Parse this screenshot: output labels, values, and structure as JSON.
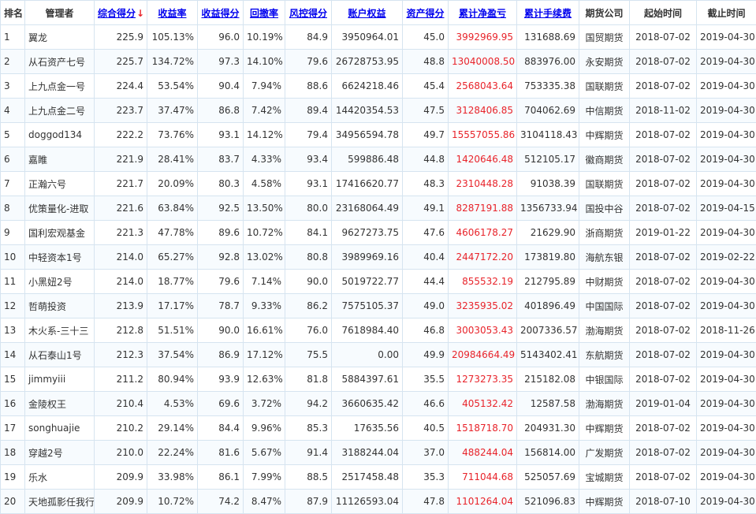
{
  "headers": {
    "rank": "排名",
    "manager": "管理者",
    "composite": "综合得分",
    "sort_arrow": "↓",
    "return_rate": "收益率",
    "return_score": "收益得分",
    "drawdown": "回撤率",
    "risk_score": "风控得分",
    "equity": "账户权益",
    "asset_score": "资产得分",
    "net_pnl": "累计净盈亏",
    "fees": "累计手续费",
    "broker": "期货公司",
    "start": "起始时间",
    "end": "截止时间"
  },
  "colors": {
    "pnl": "#e8232a",
    "link": "#0000ee",
    "border": "#d6e4f0"
  },
  "rows": [
    {
      "rank": "1",
      "manager": "翼龙",
      "composite": "225.9",
      "return_rate": "105.13%",
      "return_score": "96.0",
      "drawdown": "10.19%",
      "risk_score": "84.9",
      "equity": "3950964.01",
      "asset_score": "45.0",
      "net_pnl": "3992969.95",
      "fees": "131688.69",
      "broker": "国贸期货",
      "start": "2018-07-02",
      "end": "2019-04-30"
    },
    {
      "rank": "2",
      "manager": "从石资产七号",
      "composite": "225.7",
      "return_rate": "134.72%",
      "return_score": "97.3",
      "drawdown": "14.10%",
      "risk_score": "79.6",
      "equity": "26728753.95",
      "asset_score": "48.8",
      "net_pnl": "13040008.50",
      "fees": "883976.00",
      "broker": "永安期货",
      "start": "2018-07-02",
      "end": "2019-04-30"
    },
    {
      "rank": "3",
      "manager": "上九点金一号",
      "composite": "224.4",
      "return_rate": "53.54%",
      "return_score": "90.4",
      "drawdown": "7.94%",
      "risk_score": "88.6",
      "equity": "6624218.46",
      "asset_score": "45.4",
      "net_pnl": "2568043.64",
      "fees": "753335.38",
      "broker": "国联期货",
      "start": "2018-07-02",
      "end": "2019-04-30"
    },
    {
      "rank": "4",
      "manager": "上九点金二号",
      "composite": "223.7",
      "return_rate": "37.47%",
      "return_score": "86.8",
      "drawdown": "7.42%",
      "risk_score": "89.4",
      "equity": "14420354.53",
      "asset_score": "47.5",
      "net_pnl": "3128406.85",
      "fees": "704062.69",
      "broker": "中信期货",
      "start": "2018-11-02",
      "end": "2019-04-30"
    },
    {
      "rank": "5",
      "manager": "doggod134",
      "composite": "222.2",
      "return_rate": "73.76%",
      "return_score": "93.1",
      "drawdown": "14.12%",
      "risk_score": "79.4",
      "equity": "34956594.78",
      "asset_score": "49.7",
      "net_pnl": "15557055.86",
      "fees": "3104118.43",
      "broker": "中辉期货",
      "start": "2018-07-02",
      "end": "2019-04-30"
    },
    {
      "rank": "6",
      "manager": "嘉睢",
      "composite": "221.9",
      "return_rate": "28.41%",
      "return_score": "83.7",
      "drawdown": "4.33%",
      "risk_score": "93.4",
      "equity": "599886.48",
      "asset_score": "44.8",
      "net_pnl": "1420646.48",
      "fees": "512105.17",
      "broker": "徽商期货",
      "start": "2018-07-02",
      "end": "2019-04-30"
    },
    {
      "rank": "7",
      "manager": "正瀚六号",
      "composite": "221.7",
      "return_rate": "20.09%",
      "return_score": "80.3",
      "drawdown": "4.58%",
      "risk_score": "93.1",
      "equity": "17416620.77",
      "asset_score": "48.3",
      "net_pnl": "2310448.28",
      "fees": "91038.39",
      "broker": "国联期货",
      "start": "2018-07-02",
      "end": "2019-04-30"
    },
    {
      "rank": "8",
      "manager": "优策量化-进取",
      "composite": "221.6",
      "return_rate": "63.84%",
      "return_score": "92.5",
      "drawdown": "13.50%",
      "risk_score": "80.0",
      "equity": "23168064.49",
      "asset_score": "49.1",
      "net_pnl": "8287191.88",
      "fees": "1356733.94",
      "broker": "国投中谷",
      "start": "2018-07-02",
      "end": "2019-04-15"
    },
    {
      "rank": "9",
      "manager": "国利宏观基金",
      "composite": "221.3",
      "return_rate": "47.78%",
      "return_score": "89.6",
      "drawdown": "10.72%",
      "risk_score": "84.1",
      "equity": "9627273.75",
      "asset_score": "47.6",
      "net_pnl": "4606178.27",
      "fees": "21629.90",
      "broker": "浙商期货",
      "start": "2019-01-22",
      "end": "2019-04-30"
    },
    {
      "rank": "10",
      "manager": "中轻资本1号",
      "composite": "214.0",
      "return_rate": "65.27%",
      "return_score": "92.8",
      "drawdown": "13.02%",
      "risk_score": "80.8",
      "equity": "3989969.16",
      "asset_score": "40.4",
      "net_pnl": "2447172.20",
      "fees": "173819.80",
      "broker": "海航东银",
      "start": "2018-07-02",
      "end": "2019-02-22"
    },
    {
      "rank": "11",
      "manager": "小黑妞2号",
      "composite": "214.0",
      "return_rate": "18.77%",
      "return_score": "79.6",
      "drawdown": "7.14%",
      "risk_score": "90.0",
      "equity": "5019722.77",
      "asset_score": "44.4",
      "net_pnl": "855532.19",
      "fees": "212795.89",
      "broker": "中财期货",
      "start": "2018-07-02",
      "end": "2019-04-30"
    },
    {
      "rank": "12",
      "manager": "哲萌投资",
      "composite": "213.9",
      "return_rate": "17.17%",
      "return_score": "78.7",
      "drawdown": "9.33%",
      "risk_score": "86.2",
      "equity": "7575105.37",
      "asset_score": "49.0",
      "net_pnl": "3235935.02",
      "fees": "401896.49",
      "broker": "中国国际",
      "start": "2018-07-02",
      "end": "2019-04-30"
    },
    {
      "rank": "13",
      "manager": "木火系-三十三",
      "composite": "212.8",
      "return_rate": "51.51%",
      "return_score": "90.0",
      "drawdown": "16.61%",
      "risk_score": "76.0",
      "equity": "7618984.40",
      "asset_score": "46.8",
      "net_pnl": "3003053.43",
      "fees": "2007336.57",
      "broker": "渤海期货",
      "start": "2018-07-02",
      "end": "2018-11-26"
    },
    {
      "rank": "14",
      "manager": "从石泰山1号",
      "composite": "212.3",
      "return_rate": "37.54%",
      "return_score": "86.9",
      "drawdown": "17.12%",
      "risk_score": "75.5",
      "equity": "0.00",
      "asset_score": "49.9",
      "net_pnl": "20984664.49",
      "fees": "5143402.41",
      "broker": "东航期货",
      "start": "2018-07-02",
      "end": "2019-04-30"
    },
    {
      "rank": "15",
      "manager": "jimmyiii",
      "composite": "211.2",
      "return_rate": "80.94%",
      "return_score": "93.9",
      "drawdown": "12.63%",
      "risk_score": "81.8",
      "equity": "5884397.61",
      "asset_score": "35.5",
      "net_pnl": "1273273.35",
      "fees": "215182.08",
      "broker": "中银国际",
      "start": "2018-07-02",
      "end": "2019-04-30"
    },
    {
      "rank": "16",
      "manager": "金陵权王",
      "composite": "210.4",
      "return_rate": "4.53%",
      "return_score": "69.6",
      "drawdown": "3.72%",
      "risk_score": "94.2",
      "equity": "3660635.42",
      "asset_score": "46.6",
      "net_pnl": "405132.42",
      "fees": "12587.58",
      "broker": "渤海期货",
      "start": "2019-01-04",
      "end": "2019-04-30"
    },
    {
      "rank": "17",
      "manager": "songhuajie",
      "composite": "210.2",
      "return_rate": "29.14%",
      "return_score": "84.4",
      "drawdown": "9.96%",
      "risk_score": "85.3",
      "equity": "17635.56",
      "asset_score": "40.5",
      "net_pnl": "1518718.70",
      "fees": "204931.30",
      "broker": "中辉期货",
      "start": "2018-07-02",
      "end": "2019-04-30"
    },
    {
      "rank": "18",
      "manager": "穿越2号",
      "composite": "210.0",
      "return_rate": "22.24%",
      "return_score": "81.6",
      "drawdown": "5.67%",
      "risk_score": "91.4",
      "equity": "3188244.04",
      "asset_score": "37.0",
      "net_pnl": "488244.04",
      "fees": "156814.00",
      "broker": "广发期货",
      "start": "2018-07-02",
      "end": "2019-04-30"
    },
    {
      "rank": "19",
      "manager": "乐水",
      "composite": "209.9",
      "return_rate": "33.98%",
      "return_score": "86.1",
      "drawdown": "7.99%",
      "risk_score": "88.5",
      "equity": "2517458.48",
      "asset_score": "35.3",
      "net_pnl": "711044.68",
      "fees": "525057.69",
      "broker": "宝城期货",
      "start": "2018-07-02",
      "end": "2019-04-30"
    },
    {
      "rank": "20",
      "manager": "天地孤影任我行",
      "composite": "209.9",
      "return_rate": "10.72%",
      "return_score": "74.2",
      "drawdown": "8.47%",
      "risk_score": "87.9",
      "equity": "11126593.04",
      "asset_score": "47.8",
      "net_pnl": "1101264.04",
      "fees": "521096.83",
      "broker": "中辉期货",
      "start": "2018-07-10",
      "end": "2019-04-30"
    }
  ]
}
